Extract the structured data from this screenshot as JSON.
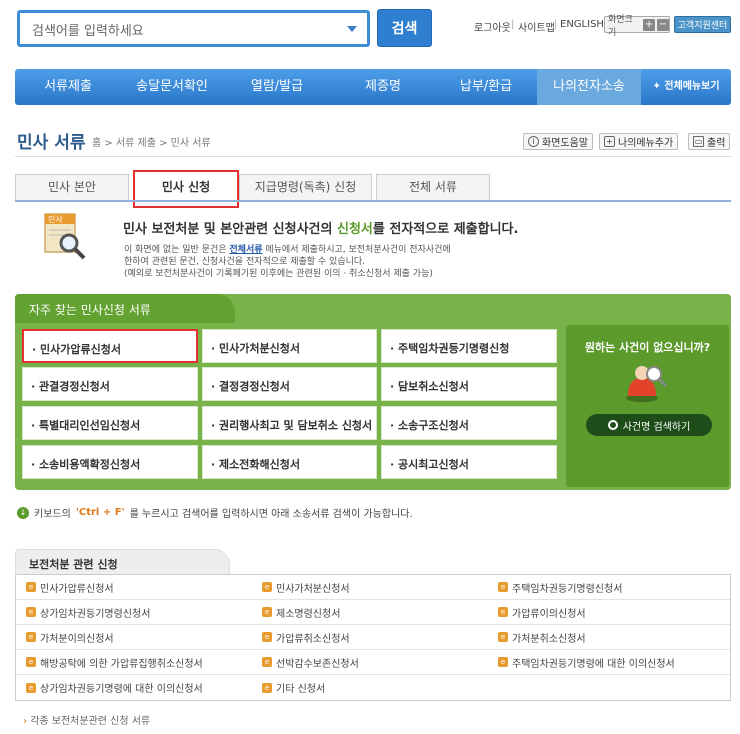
{
  "search": {
    "placeholder": "검색어를 입력하세요",
    "button": "검색"
  },
  "util": {
    "logout": "로그아웃",
    "sitemap": "사이트맵",
    "english": "ENGLISH",
    "font_size": "화면크기",
    "plus": "+",
    "minus": "−",
    "help_center": "고객지원센터"
  },
  "nav": {
    "items": [
      "서류제출",
      "송달문서확인",
      "열람/발급",
      "제증명",
      "납부/환급",
      "나의전자소송"
    ],
    "all_menu": "전체메뉴보기"
  },
  "page": {
    "title": "민사 서류",
    "breadcrumb": "홈 > 서류 제출 > 민사 서류"
  },
  "toolbar": {
    "screen_help": "화면도움말",
    "add_my_menu": "나의메뉴추가",
    "print": "출력"
  },
  "tabs": [
    "민사 본안",
    "민사 신청",
    "지급명령(독촉) 신청",
    "전체 서류"
  ],
  "intro": {
    "icon_label": "민사",
    "heading_pre": "민사 보전처분 및 본안관련 신청사건의 ",
    "heading_em": "신청서",
    "heading_post": "를 전자적으로 제출합니다.",
    "line1_pre": "이 화면에 없는 일반 문건은 ",
    "line1_link": "전체서류",
    "line1_post": " 메뉴에서 제출하시고, 보전처분사건이 전자사건에",
    "line2": "한하여 관련된 문건, 신청사건을 전자적으로 제출할 수 있습니다.",
    "line3": "(예외로 보전처분사건이 기록폐기된 이후에는 관련된 이의 · 취소신청서 제출 가능)"
  },
  "frequent": {
    "title": "자주 찾는 민사신청 서류",
    "items": [
      "· 민사가압류신청서",
      "· 민사가처분신청서",
      "· 주택임차권등기명령신청",
      "· 관결경정신청서",
      "· 결정경정신청서",
      "· 담보취소신청서",
      "· 특별대리인선임신청서",
      "· 권리행사최고 및 담보취소 신청서",
      "· 소송구조신청서",
      "· 소송비용액확정신청서",
      "· 제소전화해신청서",
      "· 공시최고신청서"
    ],
    "side_question": "원하는 사건이 없으십니까?",
    "side_button": "사건명 검색하기"
  },
  "tip": {
    "pre": "키보드의 ",
    "key": "'Ctrl + F'",
    "post": "를 누르시고 검색어를 입력하시면 아래 소송서류 검색이 가능합니다."
  },
  "section": {
    "title": "보전처분 관련 신청",
    "rows": [
      [
        "민사가압류신청서",
        "민사가처분신청서",
        "주택임차권등기명령신청서"
      ],
      [
        "상가임차권등기명령신청서",
        "제소명령신청서",
        "가압류이의신청서"
      ],
      [
        "가처분이의신청서",
        "가압류취소신청서",
        "가처분취소신청서"
      ],
      [
        "해방공탁에 의한 가압류집행취소신청서",
        "선박감수보존신청서",
        "주택임차권등기명령에 대한 이의신청서"
      ],
      [
        "상가임차권등기명령에 대한 이의신청서",
        "기타 신청서",
        ""
      ]
    ],
    "more": "각종 보전처분관련 신청 서류"
  }
}
